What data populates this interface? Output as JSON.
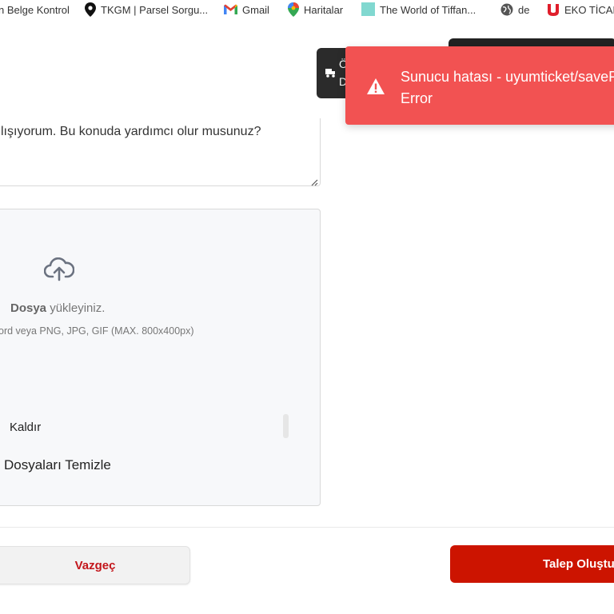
{
  "bookmarks": [
    {
      "label": "n Belge Kontrol",
      "icon": "none"
    },
    {
      "label": "TKGM | Parsel Sorgu...",
      "icon": "location-pin-icon"
    },
    {
      "label": "Gmail",
      "icon": "gmail-icon"
    },
    {
      "label": "Haritalar",
      "icon": "maps-pin-icon"
    },
    {
      "label": "The World of Tiffan...",
      "icon": "tile-icon"
    },
    {
      "label": "de",
      "icon": "globe-icon"
    },
    {
      "label": "EKO TİCAR",
      "icon": "u-logo-icon"
    }
  ],
  "header": {
    "dark_button_line1": "Ö",
    "dark_button_line2": "D"
  },
  "form": {
    "textarea_value": "lışıyorum. Bu konuda yardımcı olur musunuz?",
    "upload_title_bold": "Dosya",
    "upload_title_rest": " yükleyiniz.",
    "upload_hint": "ord veya PNG, JPG, GIF (MAX. 800x400px)",
    "remove_label": "Kaldır",
    "clear_files_label": "Dosyaları Temizle"
  },
  "actions": {
    "cancel_label": "Vazgeç",
    "submit_label": "Talep Oluştur"
  },
  "toast": {
    "message_line1": "Sunucu hatası - uyumticket/saveF",
    "message_line2": "Error"
  },
  "colors": {
    "toast_bg": "#f25252",
    "submit_bg": "#cc1400",
    "cancel_text": "#c3151b"
  }
}
